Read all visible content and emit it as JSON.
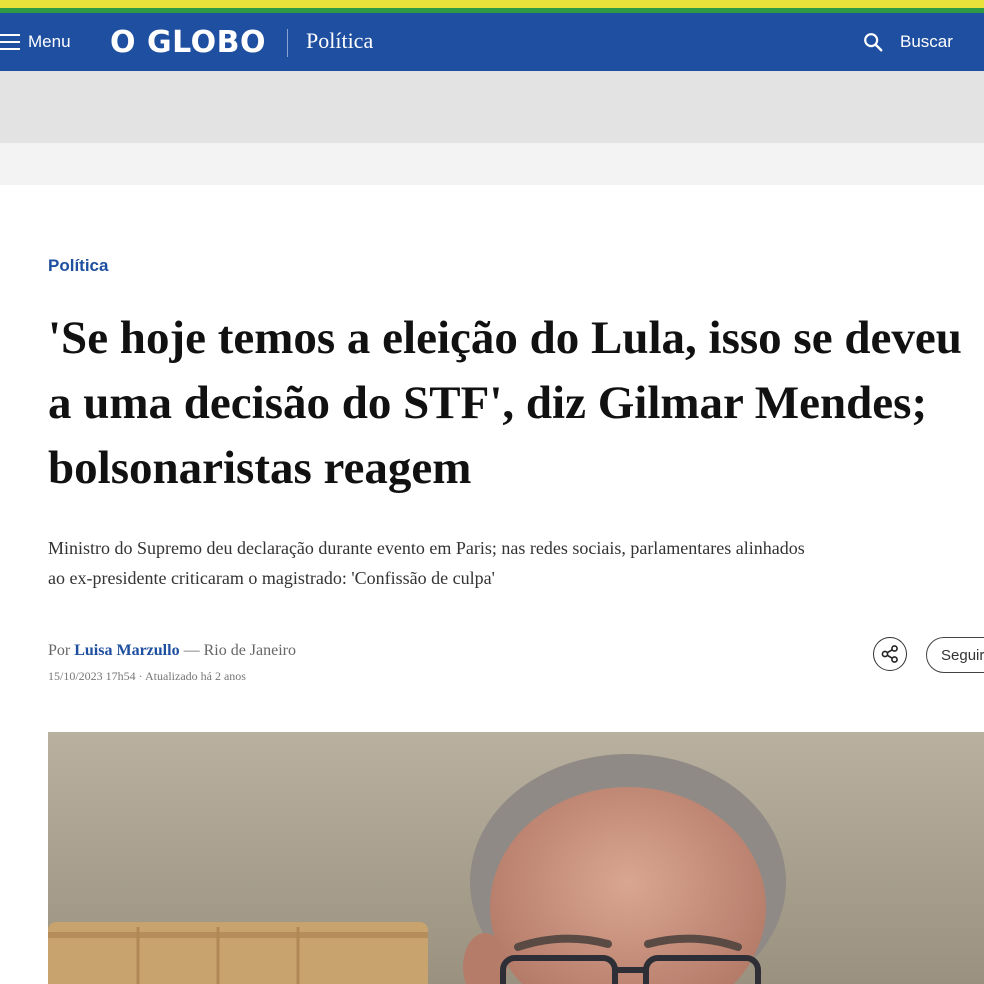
{
  "header": {
    "menu_label": "Menu",
    "logo": "O GLOBO",
    "section": "Política",
    "search_label": "Buscar"
  },
  "article": {
    "kicker": "Política",
    "headline": "'Se hoje temos a eleição do Lula, isso se deveu a uma decisão do STF', diz Gilmar Mendes; bolsonaristas reagem",
    "subtitle_line1": "Ministro do Supremo deu declaração durante evento em Paris; nas redes sociais, parlamentares alinhados",
    "subtitle_line2": "ao ex-presidente criticaram o magistrado: 'Confissão de culpa'",
    "byline_prefix": "Por",
    "author": "Luisa Marzullo",
    "location": "— Rio de Janeiro",
    "timestamp": "15/10/2023 17h54 · Atualizado há 2 anos",
    "follow_label": "Seguir"
  },
  "colors": {
    "brand_blue": "#1e4fa0",
    "stripe_yellow": "#e8e23a",
    "stripe_green": "#2f9a46"
  },
  "icons": {
    "menu": "hamburger-icon",
    "search": "search-icon",
    "share": "share-icon"
  }
}
